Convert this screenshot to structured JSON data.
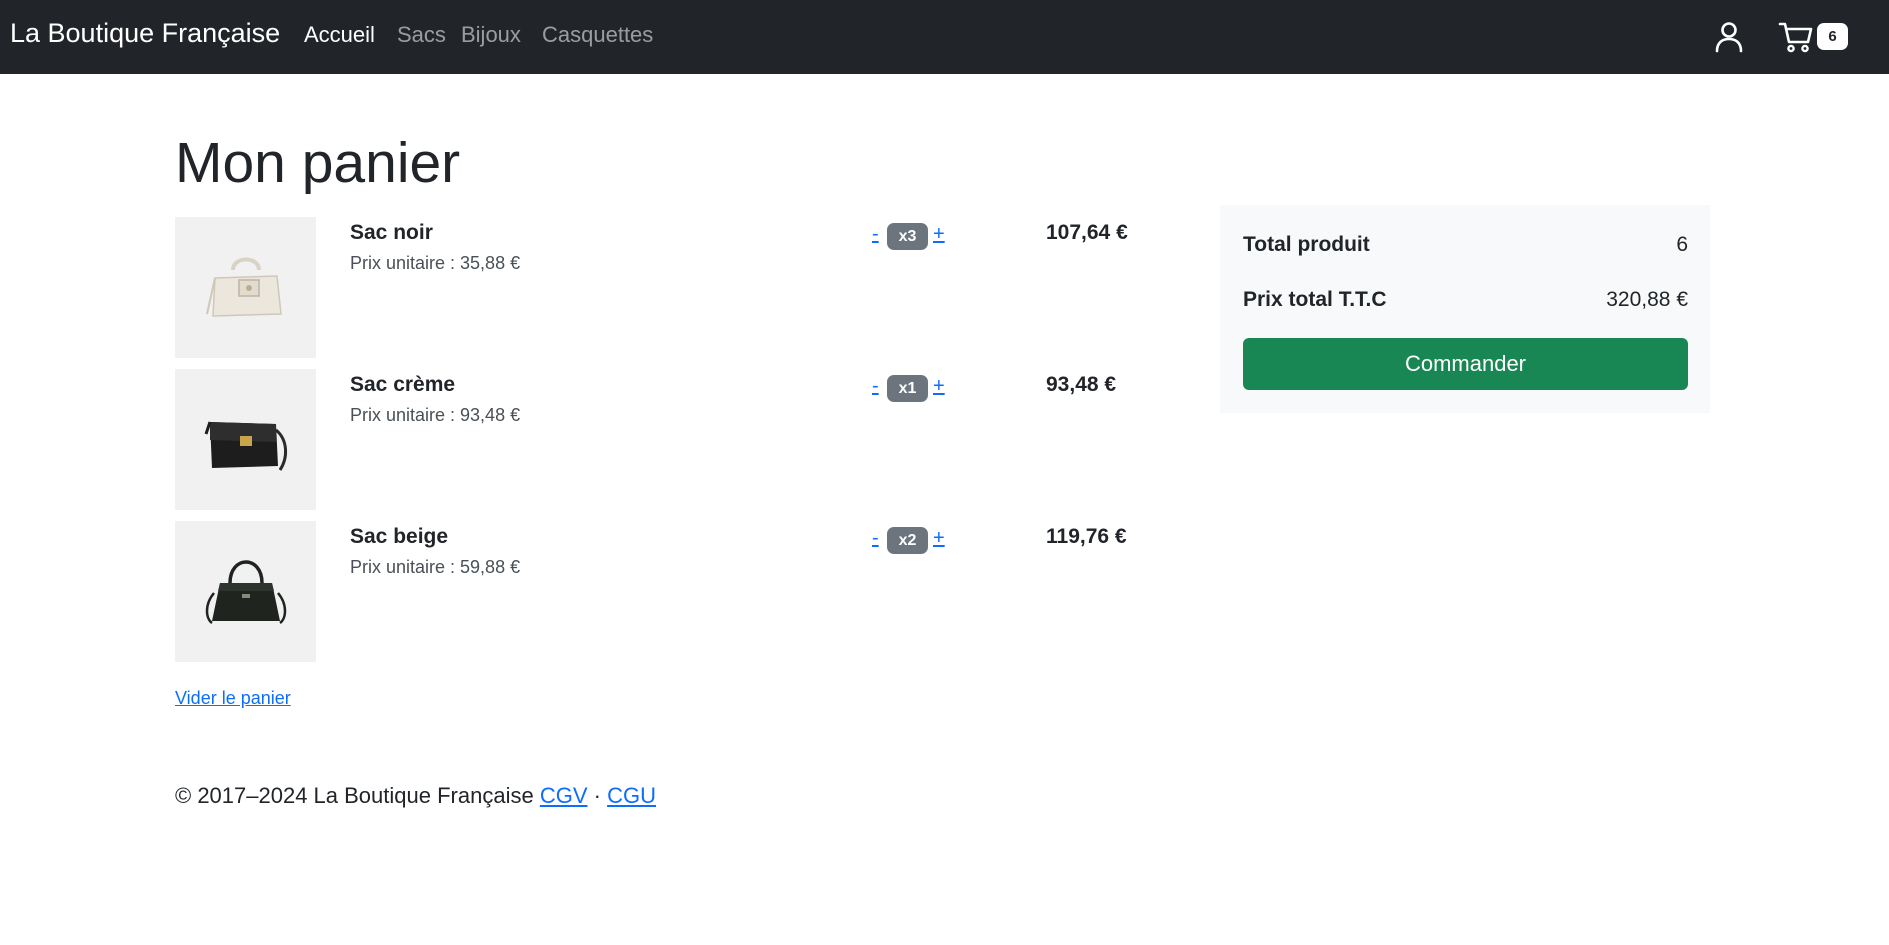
{
  "navbar": {
    "brand": "La Boutique Française",
    "links": [
      {
        "label": "Accueil",
        "active": true
      },
      {
        "label": "Sacs",
        "active": false
      },
      {
        "label": "Bijoux",
        "active": false
      },
      {
        "label": "Casquettes",
        "active": false
      }
    ],
    "icons": {
      "account": "user-icon",
      "cart": "cart-icon"
    },
    "cart_count": "6"
  },
  "page": {
    "title": "Mon panier"
  },
  "cart": {
    "items": [
      {
        "name": "Sac noir",
        "unit_price": "Prix unitaire : 35,88 €",
        "minus": "-",
        "quantity": "x3",
        "plus": "+",
        "total": "107,64 €",
        "thumbnail": "cream-handbag"
      },
      {
        "name": "Sac crème",
        "unit_price": "Prix unitaire : 93,48 €",
        "minus": "-",
        "quantity": "x1",
        "plus": "+",
        "total": "93,48 €",
        "thumbnail": "black-shoulder-bag"
      },
      {
        "name": "Sac beige",
        "unit_price": "Prix unitaire : 59,88 €",
        "minus": "-",
        "quantity": "x2",
        "plus": "+",
        "total": "119,76 €",
        "thumbnail": "black-tote-bag"
      }
    ],
    "empty_label": "Vider le panier"
  },
  "summary": {
    "total_products_label": "Total produit",
    "total_products_value": "6",
    "total_price_label": "Prix total T.T.C",
    "total_price_value": "320,88 €",
    "order_button": "Commander"
  },
  "footer": {
    "copyright": "© 2017–2024 La Boutique Française",
    "cgv": "CGV",
    "separator": "·",
    "cgu": "CGU"
  },
  "colors": {
    "navbar_bg": "#212529",
    "link": "#0d6efd",
    "badge": "#6c757d",
    "order_button": "#198754",
    "summary_bg": "#f8f9fa"
  }
}
